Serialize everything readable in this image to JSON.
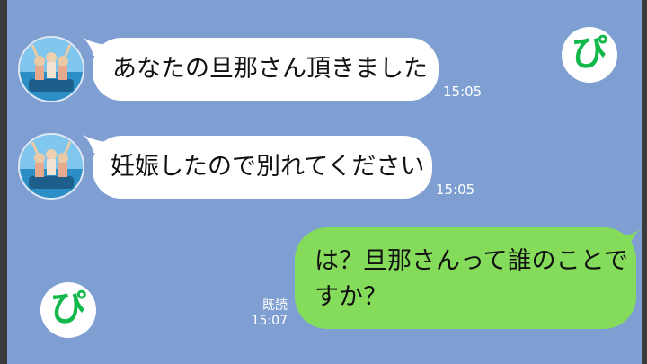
{
  "chat": {
    "messages": [
      {
        "sender": "other",
        "text": "あなたの旦那さん頂きました",
        "time": "15:05"
      },
      {
        "sender": "other",
        "text": "妊娠したので別れてください",
        "time": "15:05"
      },
      {
        "sender": "me",
        "line1": "は？旦那さんって誰のことで",
        "line2": "すか？",
        "read": "既読",
        "time": "15:07"
      }
    ]
  },
  "brand": {
    "logo_text": "ぴ",
    "color": "#12b84a"
  },
  "colors": {
    "background": "#7f9fd3",
    "incoming_bubble": "#ffffff",
    "outgoing_bubble": "#84dc5a"
  },
  "icons": [
    "avatar-photo",
    "brand-logo"
  ]
}
